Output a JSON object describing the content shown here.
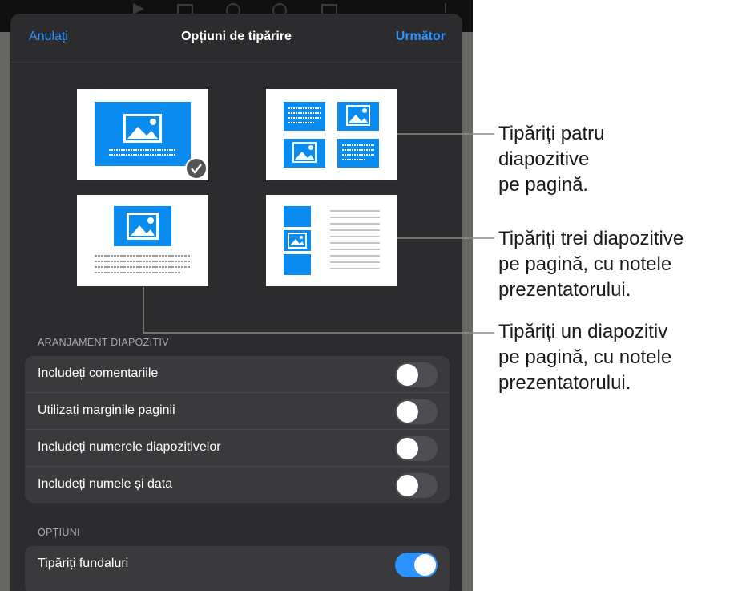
{
  "sheet": {
    "cancel_label": "Anulați",
    "title": "Opțiuni de tipărire",
    "next_label": "Următor"
  },
  "layouts": [
    {
      "id": "one-slide",
      "selected": true
    },
    {
      "id": "four-slides",
      "selected": false
    },
    {
      "id": "one-slide-notes",
      "selected": false
    },
    {
      "id": "three-slides-notes",
      "selected": false
    }
  ],
  "slide_layout_section": {
    "label": "ARANJAMENT DIAPOZITIV",
    "rows": [
      {
        "label": "Includeți comentariile",
        "on": false
      },
      {
        "label": "Utilizați marginile paginii",
        "on": false
      },
      {
        "label": "Includeți numerele diapozitivelor",
        "on": false
      },
      {
        "label": "Includeți numele și data",
        "on": false
      }
    ]
  },
  "options_section": {
    "label": "OPȚIUNI",
    "rows": [
      {
        "label": "Tipăriți fundaluri",
        "on": true
      }
    ]
  },
  "callouts": [
    {
      "line1": "Tipăriți patru",
      "line2": "diapozitive",
      "line3": "pe pagină."
    },
    {
      "line1": "Tipăriți trei diapozitive",
      "line2": "pe pagină, cu notele",
      "line3": "prezentatorului."
    },
    {
      "line1": "Tipăriți un diapozitiv",
      "line2": "pe pagină, cu notele",
      "line3": "prezentatorului."
    }
  ],
  "colors": {
    "accent": "#2a93ff",
    "slide_blue": "#0a8bf0",
    "sheet_bg": "#2c2c2e",
    "group_bg": "#3a3a3c"
  }
}
